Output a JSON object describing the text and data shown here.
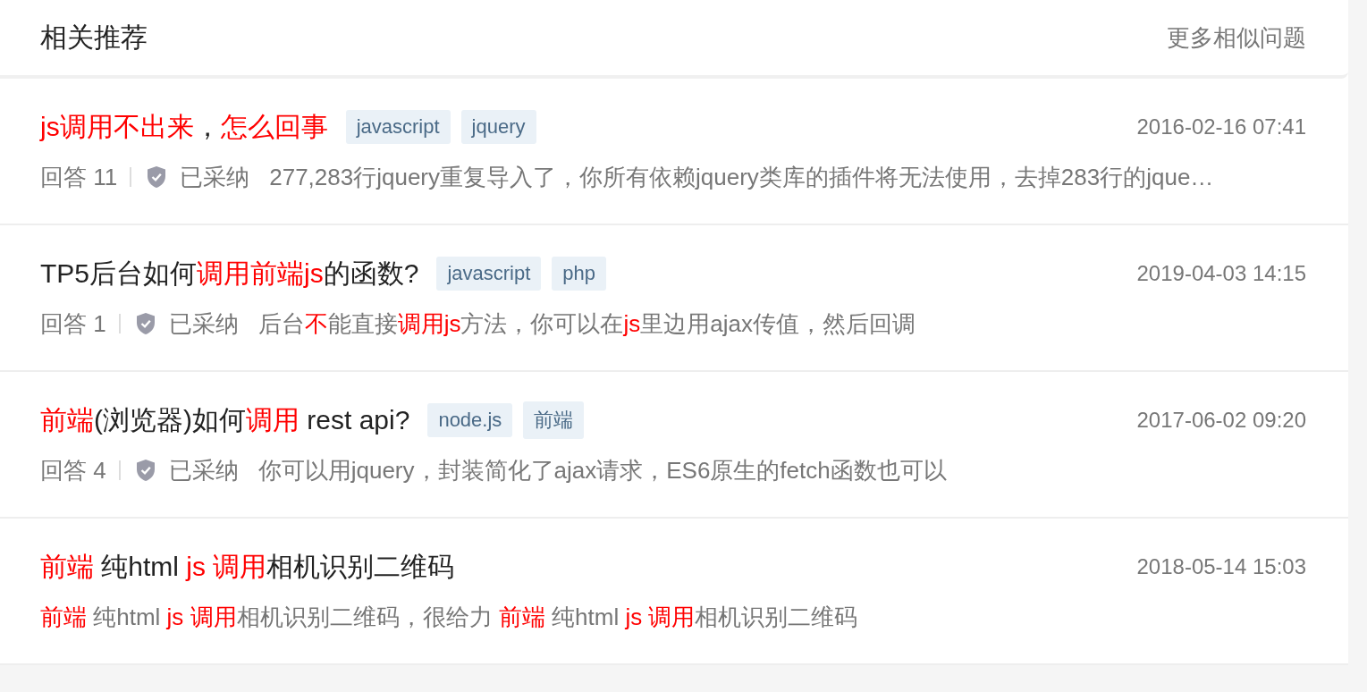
{
  "header": {
    "title": "相关推荐",
    "more_link": "更多相似问题"
  },
  "questions": [
    {
      "title": [
        {
          "text": "js调用不出来",
          "highlight": true
        },
        {
          "text": "，",
          "highlight": false
        },
        {
          "text": "怎么回事",
          "highlight": true
        }
      ],
      "tags": [
        "javascript",
        "jquery"
      ],
      "date": "2016-02-16 07:41",
      "answers": "回答 11",
      "accepted": true,
      "accepted_label": "已采纳",
      "excerpt": [
        {
          "text": "277,283行jquery重复导入了，你所有依赖jquery类库的插件将无法使用，去掉283行的jque…",
          "highlight": false
        }
      ]
    },
    {
      "title": [
        {
          "text": "TP5后台如何",
          "highlight": false
        },
        {
          "text": "调用前端js",
          "highlight": true
        },
        {
          "text": "的函数?",
          "highlight": false
        }
      ],
      "tags": [
        "javascript",
        "php"
      ],
      "date": "2019-04-03 14:15",
      "answers": "回答 1",
      "accepted": true,
      "accepted_label": "已采纳",
      "excerpt": [
        {
          "text": "后台",
          "highlight": false
        },
        {
          "text": "不",
          "highlight": true
        },
        {
          "text": "能直接",
          "highlight": false
        },
        {
          "text": "调用js",
          "highlight": true
        },
        {
          "text": "方法，你可以在",
          "highlight": false
        },
        {
          "text": "js",
          "highlight": true
        },
        {
          "text": "里边用ajax传值，然后回调",
          "highlight": false
        }
      ]
    },
    {
      "title": [
        {
          "text": "前端",
          "highlight": true
        },
        {
          "text": "(浏览器)如何",
          "highlight": false
        },
        {
          "text": "调用",
          "highlight": true
        },
        {
          "text": " rest api?",
          "highlight": false
        }
      ],
      "tags": [
        "node.js",
        "前端"
      ],
      "date": "2017-06-02 09:20",
      "answers": "回答 4",
      "accepted": true,
      "accepted_label": "已采纳",
      "excerpt": [
        {
          "text": "你可以用jquery，封装简化了ajax请求，ES6原生的fetch函数也可以",
          "highlight": false
        }
      ]
    },
    {
      "title": [
        {
          "text": "前端",
          "highlight": true
        },
        {
          "text": " 纯html ",
          "highlight": false
        },
        {
          "text": "js 调用",
          "highlight": true
        },
        {
          "text": "相机识别二维码",
          "highlight": false
        }
      ],
      "date": "2018-05-14 15:03",
      "accepted": false,
      "excerpt": [
        {
          "text": "前端",
          "highlight": true
        },
        {
          "text": " 纯html ",
          "highlight": false
        },
        {
          "text": "js 调用",
          "highlight": true
        },
        {
          "text": "相机识别二维码，很给力 ",
          "highlight": false
        },
        {
          "text": "前端",
          "highlight": true
        },
        {
          "text": " 纯html ",
          "highlight": false
        },
        {
          "text": "js 调用",
          "highlight": true
        },
        {
          "text": "相机识别二维码",
          "highlight": false
        }
      ]
    }
  ]
}
